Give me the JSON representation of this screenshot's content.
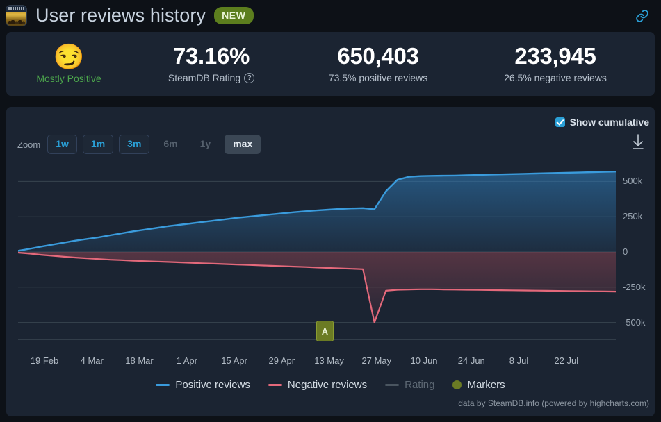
{
  "header": {
    "title": "User reviews history",
    "badge": "NEW",
    "game_icon": "game-capsule-icon",
    "link_icon": "link-icon"
  },
  "stats": {
    "verdict_emoji": "😏",
    "verdict": "Mostly Positive",
    "rating_value": "73.16%",
    "rating_label": "SteamDB Rating",
    "rating_help": "?",
    "positive_count": "650,403",
    "positive_sub": "73.5% positive reviews",
    "negative_count": "233,945",
    "negative_sub": "26.5% negative reviews"
  },
  "controls": {
    "cumulative_label": "Show cumulative",
    "cumulative_checked": true,
    "zoom_label": "Zoom",
    "zoom_buttons": [
      {
        "label": "1w",
        "state": "avail"
      },
      {
        "label": "1m",
        "state": "avail"
      },
      {
        "label": "3m",
        "state": "avail"
      },
      {
        "label": "6m",
        "state": "disabled"
      },
      {
        "label": "1y",
        "state": "disabled"
      },
      {
        "label": "max",
        "state": "selected"
      }
    ],
    "download_icon": "download-icon"
  },
  "legend": [
    {
      "label": "Positive reviews",
      "color": "#3a9bdc",
      "type": "line",
      "enabled": true
    },
    {
      "label": "Negative reviews",
      "color": "#e4697b",
      "type": "line",
      "enabled": true
    },
    {
      "label": "Rating",
      "color": "#4a5560",
      "type": "line",
      "enabled": false
    },
    {
      "label": "Markers",
      "color": "#6b7b24",
      "type": "dot",
      "enabled": true
    }
  ],
  "credit": "data by SteamDB.info (powered by highcharts.com)",
  "marker": {
    "label": "A"
  },
  "chart_data": {
    "type": "area",
    "title": "User reviews history",
    "xlabel": "",
    "ylabel": "",
    "ylim": [
      -625000,
      625000
    ],
    "yticks": [
      500000,
      250000,
      0,
      -250000,
      -500000
    ],
    "ytick_labels": [
      "500k",
      "250k",
      "0",
      "-250k",
      "-500k"
    ],
    "grid": true,
    "legend_position": "bottom",
    "xtick_labels": [
      "19 Feb",
      "4 Mar",
      "18 Mar",
      "1 Apr",
      "15 Apr",
      "29 Apr",
      "13 May",
      "27 May",
      "10 Jun",
      "24 Jun",
      "8 Jul",
      "22 Jul"
    ],
    "annotations": [
      {
        "label": "A",
        "x": "6 May",
        "kind": "marker-flag"
      }
    ],
    "series": [
      {
        "name": "Positive reviews",
        "color": "#3a9bdc",
        "values": [
          8000,
          22000,
          38000,
          52000,
          66000,
          80000,
          92000,
          104000,
          118000,
          132000,
          146000,
          158000,
          170000,
          182000,
          192000,
          202000,
          212000,
          222000,
          232000,
          242000,
          250000,
          258000,
          266000,
          274000,
          282000,
          289000,
          295000,
          300000,
          305000,
          309000,
          311000,
          303000,
          430000,
          512000,
          533000,
          538000,
          540000,
          541000,
          542000,
          544000,
          546000,
          548000,
          550000,
          552000,
          554000,
          556000,
          558000,
          560000,
          562000,
          564000,
          566000,
          568000,
          570000
        ]
      },
      {
        "name": "Negative reviews",
        "color": "#e4697b",
        "values": [
          -5000,
          -12000,
          -20000,
          -27000,
          -34000,
          -40000,
          -45000,
          -50000,
          -55000,
          -58000,
          -62000,
          -65000,
          -68000,
          -71000,
          -74000,
          -77000,
          -80000,
          -83000,
          -86000,
          -89000,
          -92000,
          -95000,
          -98000,
          -101000,
          -104000,
          -107000,
          -110000,
          -113000,
          -116000,
          -119000,
          -122000,
          -500000,
          -275000,
          -268000,
          -266000,
          -265000,
          -265000,
          -266000,
          -267000,
          -268000,
          -269000,
          -270000,
          -271000,
          -272000,
          -273000,
          -274000,
          -275000,
          -276000,
          -277000,
          -278000,
          -279000,
          -280000,
          -281000
        ]
      },
      {
        "name": "Rating",
        "color": "#4a5560",
        "enabled": false,
        "values": []
      }
    ]
  }
}
